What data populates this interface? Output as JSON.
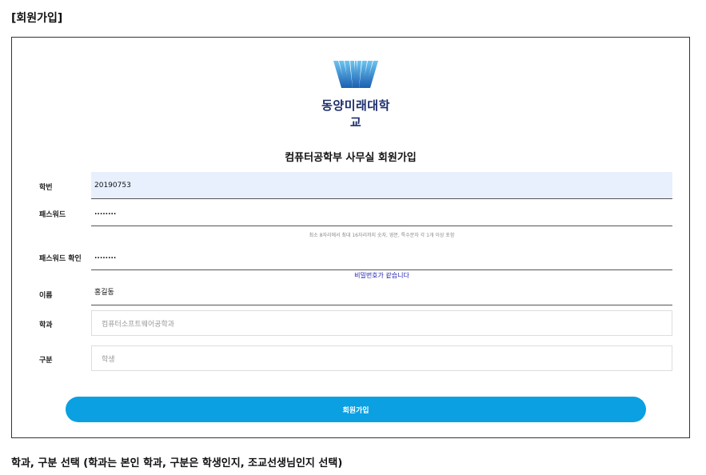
{
  "captions": {
    "top": "[회원가입]",
    "bottom": "학과, 구분 선택 (학과는 본인 학과, 구분은 학생인지, 조교선생님인지 선택)"
  },
  "logo": {
    "text": "동양미래대학교",
    "icon": "university-logo-icon",
    "color": "#1a7fd4"
  },
  "form": {
    "title": "컴퓨터공학부 사무실 회원가입",
    "student_id": {
      "label": "학번",
      "value": "20190753"
    },
    "password": {
      "label": "패스워드",
      "value": "........"
    },
    "password_hint": "최소 8자리에서 최대 16자리까지 숫자, 영문, 특수문자 각 1개 이상 포함",
    "password_confirm": {
      "label": "패스워드 확인",
      "value": "........"
    },
    "password_match": "비밀번호가 같습니다",
    "name": {
      "label": "이름",
      "value": "홍길동"
    },
    "department": {
      "label": "학과",
      "placeholder": "컴퓨터소프트웨어공학과"
    },
    "category": {
      "label": "구분",
      "placeholder": "학생"
    },
    "submit_label": "회원가입"
  },
  "colors": {
    "accent": "#0aa0e2",
    "autofill": "#e8f0fe",
    "match_text": "#1a1ab0"
  }
}
